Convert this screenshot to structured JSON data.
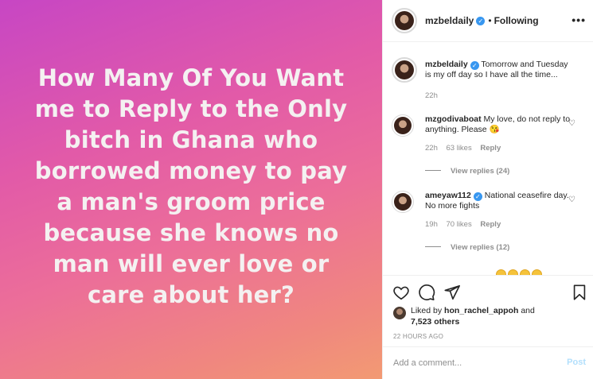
{
  "post": {
    "text": "How Many Of You Want me to Reply to the Only bitch in Ghana who borrowed money to pay a man's groom price because she knows no man will ever love or care about her?"
  },
  "header": {
    "username": "mzbeldaily",
    "separator": "•",
    "follow_state": "Following",
    "more_icon": "more-options-icon"
  },
  "caption": {
    "username": "mzbeldaily",
    "text": "Tomorrow and Tuesday is my off day so I have all the time...",
    "time": "22h"
  },
  "comments": [
    {
      "username": "mzgodivaboat",
      "text": "My love, do not reply to anything. Please 😘",
      "time": "22h",
      "likes": "63 likes",
      "reply_label": "Reply",
      "view_replies": "View replies (24)"
    },
    {
      "username": "ameyaw112",
      "text": "National ceasefire day. No more fights",
      "time": "19h",
      "likes": "70 likes",
      "reply_label": "Reply",
      "view_replies": "View replies (12)"
    }
  ],
  "likes": {
    "prefix": "Liked by",
    "user": "hon_rachel_appoh",
    "and": "and",
    "others": "7,523 others"
  },
  "timestamp": "22 HOURS AGO",
  "add_comment": {
    "placeholder": "Add a comment...",
    "post_label": "Post"
  },
  "colors": {
    "verified": "#3897f0",
    "post_button_disabled": "#b2dffc",
    "gradient_start": "#c746c4",
    "gradient_end": "#f29a73"
  }
}
